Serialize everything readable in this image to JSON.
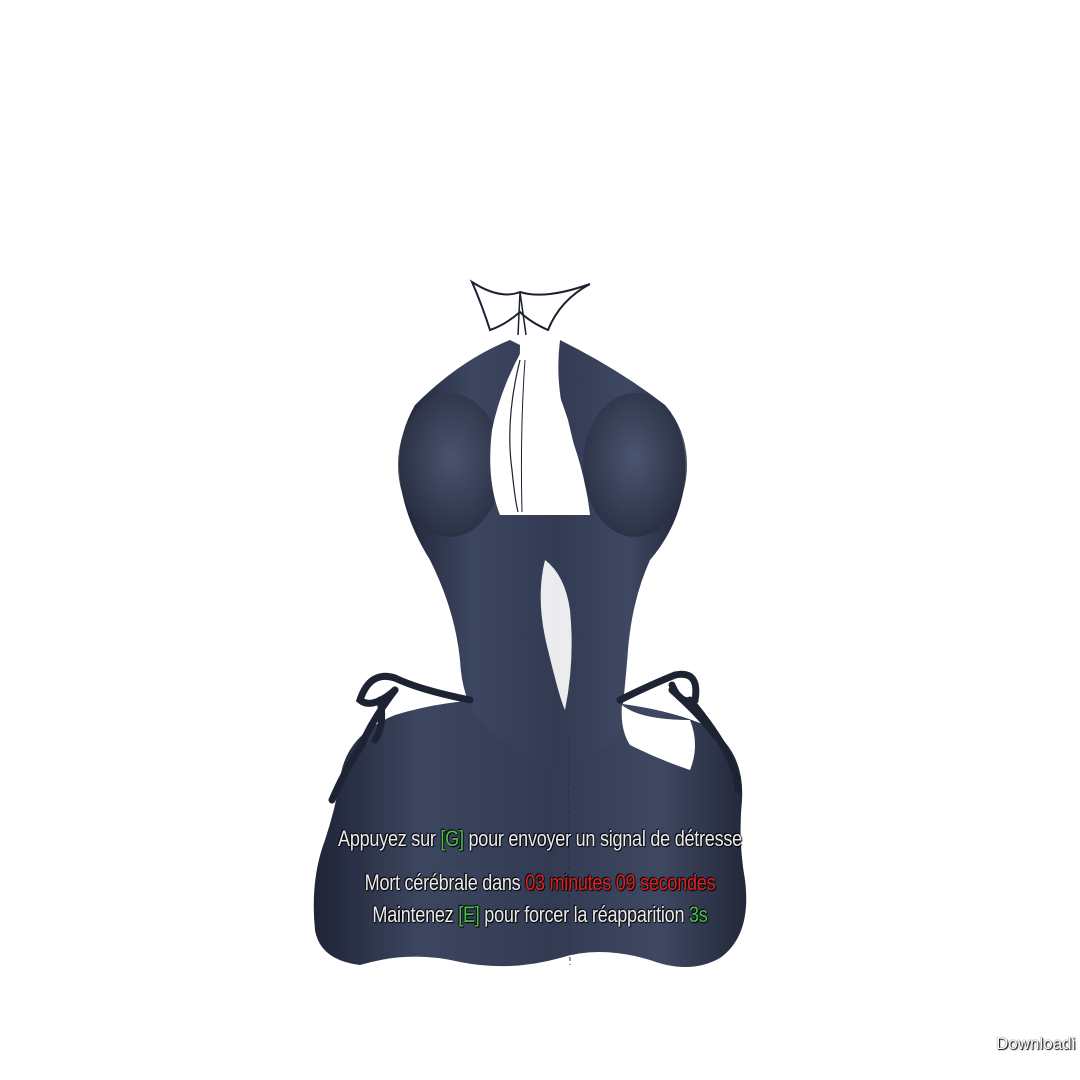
{
  "hud": {
    "distress": {
      "before": "Appuyez sur",
      "key": "[G]",
      "after": "pour envoyer un signal de détresse"
    },
    "death": {
      "before": "Mort cérébrale dans",
      "time": "03 minutes 09 secondes"
    },
    "respawn": {
      "before": "Maintenez",
      "key": "[E]",
      "middle": "pour forcer la réapparition",
      "seconds": "3s"
    }
  },
  "watermark": "Downloadi",
  "colors": {
    "key_accent": "#4bc14b",
    "timer_accent": "#e32020",
    "garment": "#3a4259"
  }
}
